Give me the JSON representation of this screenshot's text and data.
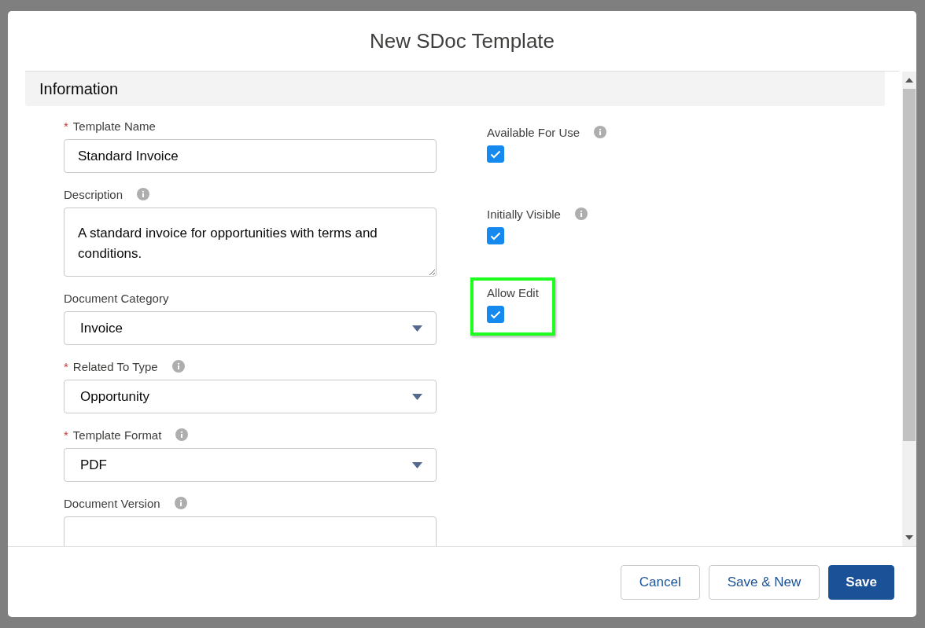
{
  "modal": {
    "title": "New SDoc Template",
    "section": {
      "title": "Information"
    },
    "left_fields": [
      {
        "kind": "text",
        "label": "Template Name",
        "required_mark": "*",
        "info": false,
        "value": "Standard Invoice"
      },
      {
        "kind": "textarea",
        "label": "Description",
        "info": true,
        "value": "A standard invoice for opportunities with terms and conditions."
      },
      {
        "kind": "select",
        "label": "Document Category",
        "info": false,
        "value": "Invoice"
      },
      {
        "kind": "select",
        "label": "Related To Type",
        "required_mark": "*",
        "info": true,
        "value": "Opportunity"
      },
      {
        "kind": "select",
        "label": "Template Format",
        "required_mark": "*",
        "info": true,
        "value": "PDF"
      },
      {
        "kind": "text",
        "label": "Document Version",
        "info": true
      }
    ],
    "right_fields": [
      {
        "label": "Available For Use",
        "info": true,
        "checked": true,
        "highlighted": false
      },
      {
        "label": "Initially Visible",
        "info": true,
        "checked": true,
        "highlighted": false
      },
      {
        "label": "Allow Edit",
        "info": false,
        "checked": true,
        "highlighted": true
      }
    ],
    "buttons": [
      {
        "label": "Cancel",
        "kind": "neutral"
      },
      {
        "label": "Save & New",
        "kind": "neutral"
      },
      {
        "label": "Save",
        "kind": "brand"
      }
    ]
  }
}
